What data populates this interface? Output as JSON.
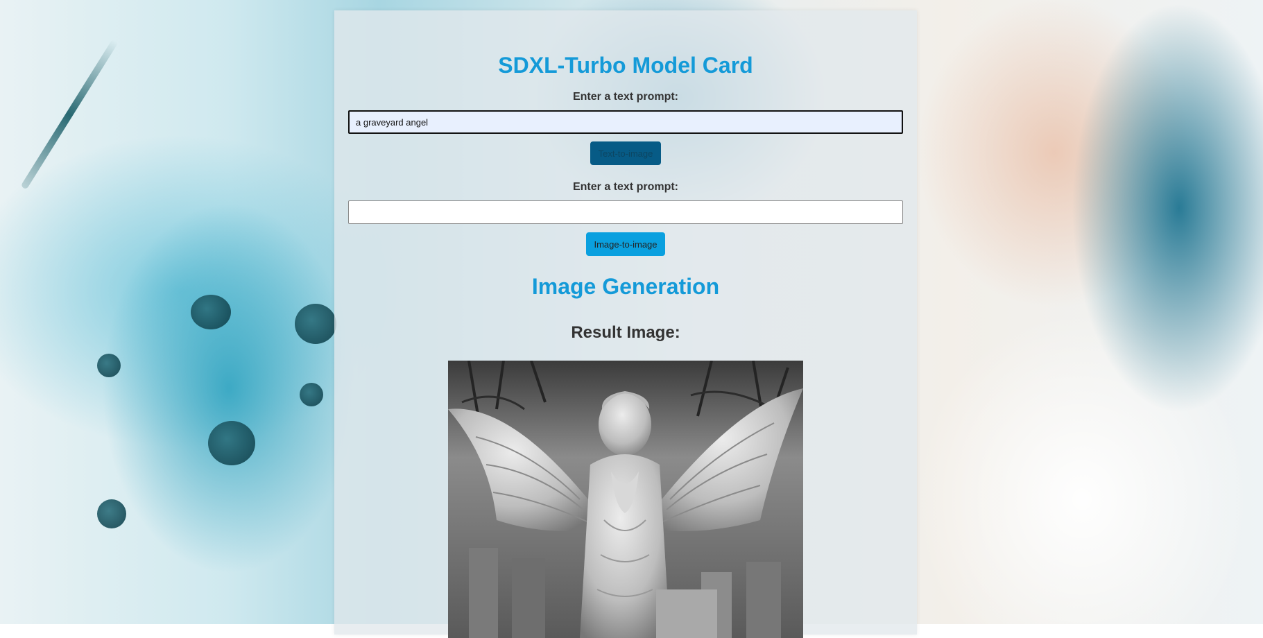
{
  "page": {
    "title": "SDXL-Turbo Model Card"
  },
  "text_to_image": {
    "label": "Enter a text prompt:",
    "value": "a graveyard angel",
    "button_label": "Text-to-image"
  },
  "image_to_image": {
    "label": "Enter a text prompt:",
    "value": "",
    "button_label": "Image-to-image"
  },
  "generation": {
    "section_title": "Image Generation",
    "result_title": "Result Image:"
  },
  "colors": {
    "accent": "#149ad8",
    "button": "#0aa0df",
    "button_pressed": "#075b86"
  }
}
